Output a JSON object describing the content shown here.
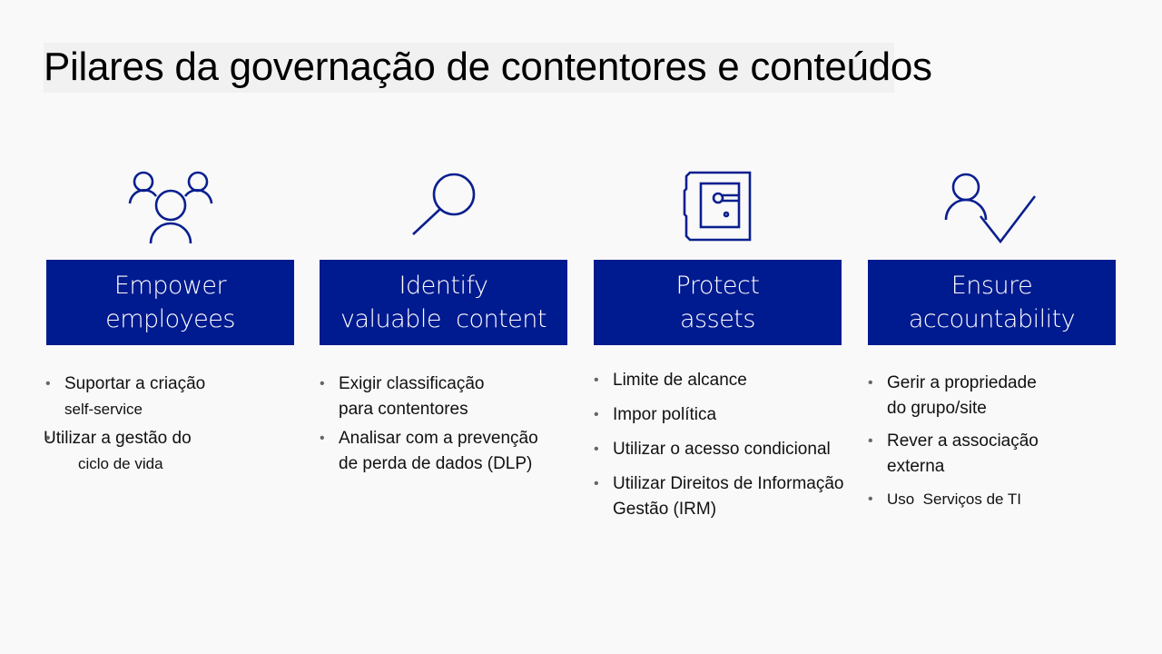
{
  "title": "Pilares da governação de contentores e conteúdos",
  "colors": {
    "accent": "#001a8f",
    "icon": "#0a1f8f",
    "background": "#f9f9f9"
  },
  "pillars": [
    {
      "icon": "people-group-icon",
      "line1": "Empower",
      "line2": "employees",
      "bullets": [
        {
          "line1": "Suportar a criação",
          "line2": "self-service"
        },
        {
          "line1": "Utilizar a gestão do",
          "line2": "ciclo de vida"
        }
      ]
    },
    {
      "icon": "magnifier-icon",
      "line1": "Identify",
      "line2": "valuable  content",
      "bullets": [
        {
          "line1": "Exigir classificação",
          "line2": "para contentores"
        },
        {
          "line1": "Analisar com a prevenção",
          "line2": "de perda de dados (DLP)"
        }
      ]
    },
    {
      "icon": "vault-icon",
      "line1": "Protect",
      "line2": "assets",
      "bullets": [
        {
          "line1": "Limite de alcance",
          "line2": ""
        },
        {
          "line1": "Impor política",
          "line2": ""
        },
        {
          "line1": "Utilizar o acesso condicional",
          "line2": ""
        },
        {
          "line1": "Utilizar Direitos de Informação",
          "line2": "Gestão (IRM)"
        }
      ]
    },
    {
      "icon": "user-check-icon",
      "line1": "Ensure",
      "line2": "accountability",
      "bullets": [
        {
          "line1": "Gerir a propriedade",
          "line2": "do grupo/site"
        },
        {
          "line1": "Rever a associação",
          "line2": "externa"
        },
        {
          "line1": "Uso  Serviços de TI",
          "line2": ""
        }
      ]
    }
  ]
}
